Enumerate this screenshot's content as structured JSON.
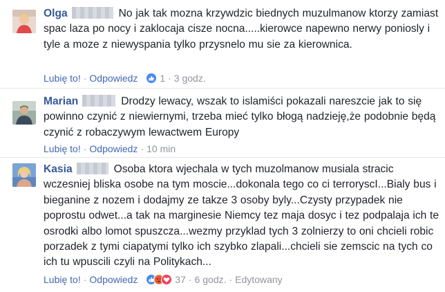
{
  "comments": [
    {
      "author": "Olga",
      "text": "No jak tak mozna krzywdzic biednych muzulmanow ktorzy zamiast spac laza po nocy i zaklocaja cisze nocna.....kierowce napewno nerwy poniosly i tyle a moze z niewyspania tylko przysnelo mu sie za kierownica.",
      "like_label": "Lubię to!",
      "reply_label": "Odpowiedz",
      "reactions": [
        "like-icon"
      ],
      "reaction_count": "1",
      "time": "3 godz.",
      "edited": ""
    },
    {
      "author": "Marian",
      "text": "Drodzy lewacy, wszak to islamiści pokazali nareszcie jak to się powinno czynić z niewiernymi, trzeba mieć tylko błogą nadzieję,że podobnie będą czynić z robaczywym lewactwem Europy",
      "like_label": "Lubię to!",
      "reply_label": "Odpowiedz",
      "reactions": [],
      "reaction_count": "",
      "time": "10 min",
      "edited": ""
    },
    {
      "author": "Kasia",
      "text": "Osoba ktora wjechala w tych muzolmanow musiala stracic wczesniej bliska osobe na tym moscie...dokonala tego co ci terroryscI...Bialy bus i bieganine z nozem i dodajmy ze takze 3 osoby byly...Czysty przypadek nie poprostu odwet...a tak na marginesie Niemcy tez maja dosyc i tez podpalaja ich te osrodki albo lomot spuszcza...wezmy przyklad tych 3 zolnierzy to oni chcieli robic porzadek z tymi ciapatymi tylko ich szybko zlapali...chcieli sie zemscic na tych co ich tu wpuscili czyli na Politykach...",
      "like_label": "Lubię to!",
      "reply_label": "Odpowiedz",
      "reactions": [
        "like-icon",
        "angry-icon",
        "love-icon"
      ],
      "reaction_count": "37",
      "time": "6 godz.",
      "edited": "Edytowany"
    }
  ],
  "colors": {
    "author": "#365899",
    "link": "#4267b2",
    "meta": "#90949c",
    "text": "#1d2129",
    "like": "#4a89f3",
    "angry": "#f0a23a",
    "love": "#f2415e"
  }
}
